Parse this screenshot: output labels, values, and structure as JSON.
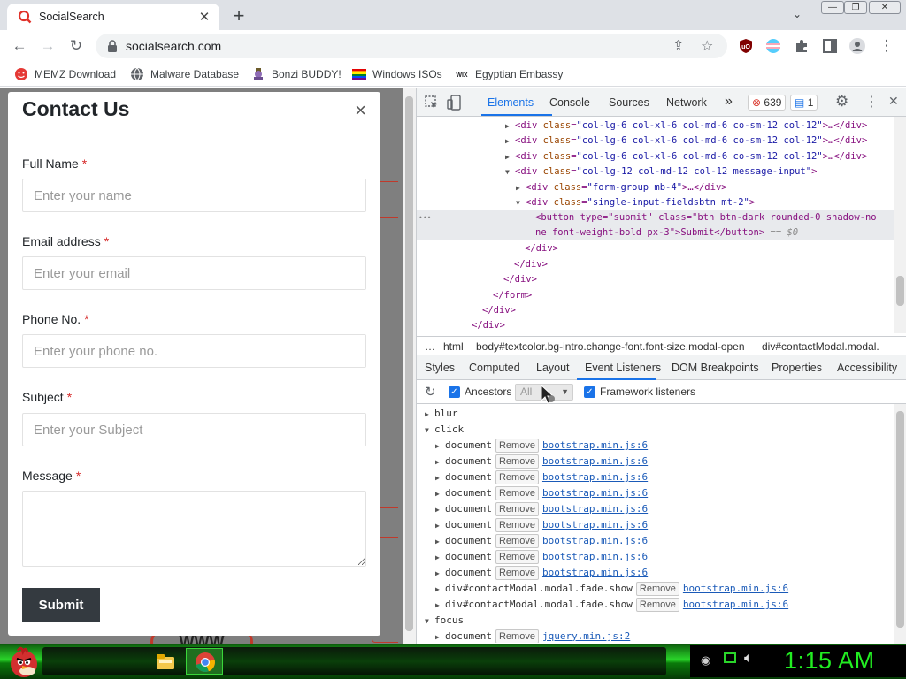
{
  "tab": {
    "title": "SocialSearch",
    "close": "✕"
  },
  "newtab": "+",
  "tabsearch": "⌄",
  "window": {
    "min": "—",
    "restore": "❐",
    "close": "✕"
  },
  "toolbar": {
    "back": "←",
    "forward": "→",
    "reload": "↻",
    "url": "socialsearch.com",
    "share": "⇪",
    "star": "☆",
    "menu": "⋮"
  },
  "bookmarks": [
    "MEMZ Download",
    "Malware Database",
    "Bonzi BUDDY!",
    "Windows ISOs",
    "Egyptian Embassy"
  ],
  "modal": {
    "title": "Contact Us",
    "close": "×",
    "fields": [
      {
        "label": "Full Name",
        "placeholder": "Enter your name"
      },
      {
        "label": "Email address",
        "placeholder": "Enter your email"
      },
      {
        "label": "Phone No.",
        "placeholder": "Enter your phone no."
      },
      {
        "label": "Subject",
        "placeholder": "Enter your Subject"
      }
    ],
    "message_label": "Message",
    "required_mark": "*",
    "submit": "Submit"
  },
  "page_bg_text": "WWW",
  "devtools": {
    "tabs": [
      "Elements",
      "Console",
      "Sources",
      "Network"
    ],
    "more": "»",
    "errors": "639",
    "messages": "1",
    "settings": "⚙",
    "kebab": "⋮",
    "close": "✕",
    "elements": [
      {
        "indent": 100,
        "open": false,
        "tag": "div",
        "cls": "col-lg-6 col-xl-6 col-md-6 co-sm-12 col-12",
        "tail": "…</div>"
      },
      {
        "indent": 100,
        "open": false,
        "tag": "div",
        "cls": "col-lg-6 col-xl-6 col-md-6 co-sm-12 col-12",
        "tail": "…</div>"
      },
      {
        "indent": 100,
        "open": false,
        "tag": "div",
        "cls": "col-lg-6 col-xl-6 col-md-6 co-sm-12 col-12",
        "tail": "…</div>"
      },
      {
        "indent": 100,
        "open": true,
        "tag": "div",
        "cls": "col-lg-12 col-md-12 col-12 message-input",
        "tail": ""
      },
      {
        "indent": 112,
        "open": false,
        "tag": "div",
        "cls": "form-group mb-4",
        "tail": "…</div>"
      },
      {
        "indent": 112,
        "open": true,
        "tag": "div",
        "cls": "single-input-fieldsbtn mt-2",
        "tail": ""
      }
    ],
    "selected_line1": "<button type=\"submit\" class=\"btn btn-dark rounded-0 shadow-no",
    "selected_line2": "ne font-weight-bold px-3\">Submit</button>",
    "selected_eq": "== $0",
    "closing": [
      {
        "indent": 122,
        "text": "</div>"
      },
      {
        "indent": 110,
        "text": "</div>"
      },
      {
        "indent": 98,
        "text": "</div>"
      },
      {
        "indent": 86,
        "text": "</form>"
      },
      {
        "indent": 74,
        "text": "</div>"
      },
      {
        "indent": 62,
        "text": "</div>"
      }
    ],
    "crumbs": [
      "…",
      "html",
      "body#textcolor.bg-intro.change-font.font-size.modal-open",
      "div#contactModal.modal."
    ],
    "subtabs": [
      "Styles",
      "Computed",
      "Layout",
      "Event Listeners",
      "DOM Breakpoints",
      "Properties",
      "Accessibility"
    ],
    "ancestors": "Ancestors",
    "all": "All",
    "framework": "Framework listeners",
    "remove": "Remove",
    "events": {
      "blur": "blur",
      "click": "click",
      "focus": "focus"
    },
    "click_listeners": [
      {
        "target": "document",
        "file": "bootstrap.min.js:6"
      },
      {
        "target": "document",
        "file": "bootstrap.min.js:6"
      },
      {
        "target": "document",
        "file": "bootstrap.min.js:6"
      },
      {
        "target": "document",
        "file": "bootstrap.min.js:6"
      },
      {
        "target": "document",
        "file": "bootstrap.min.js:6"
      },
      {
        "target": "document",
        "file": "bootstrap.min.js:6"
      },
      {
        "target": "document",
        "file": "bootstrap.min.js:6"
      },
      {
        "target": "document",
        "file": "bootstrap.min.js:6"
      },
      {
        "target": "document",
        "file": "bootstrap.min.js:6"
      },
      {
        "target": "div#contactModal.modal.fade.show",
        "file": "bootstrap.min.js:6"
      },
      {
        "target": "div#contactModal.modal.fade.show",
        "file": "bootstrap.min.js:6"
      }
    ],
    "focus_listeners": [
      {
        "target": "document",
        "file": "jquery.min.js:2"
      }
    ]
  },
  "clock": "1:15 AM",
  "colors": {
    "accent": "#1a73e8",
    "required": "#d62a2a",
    "submit_bg": "#343a40",
    "taskbar_green": "#22ee22"
  }
}
